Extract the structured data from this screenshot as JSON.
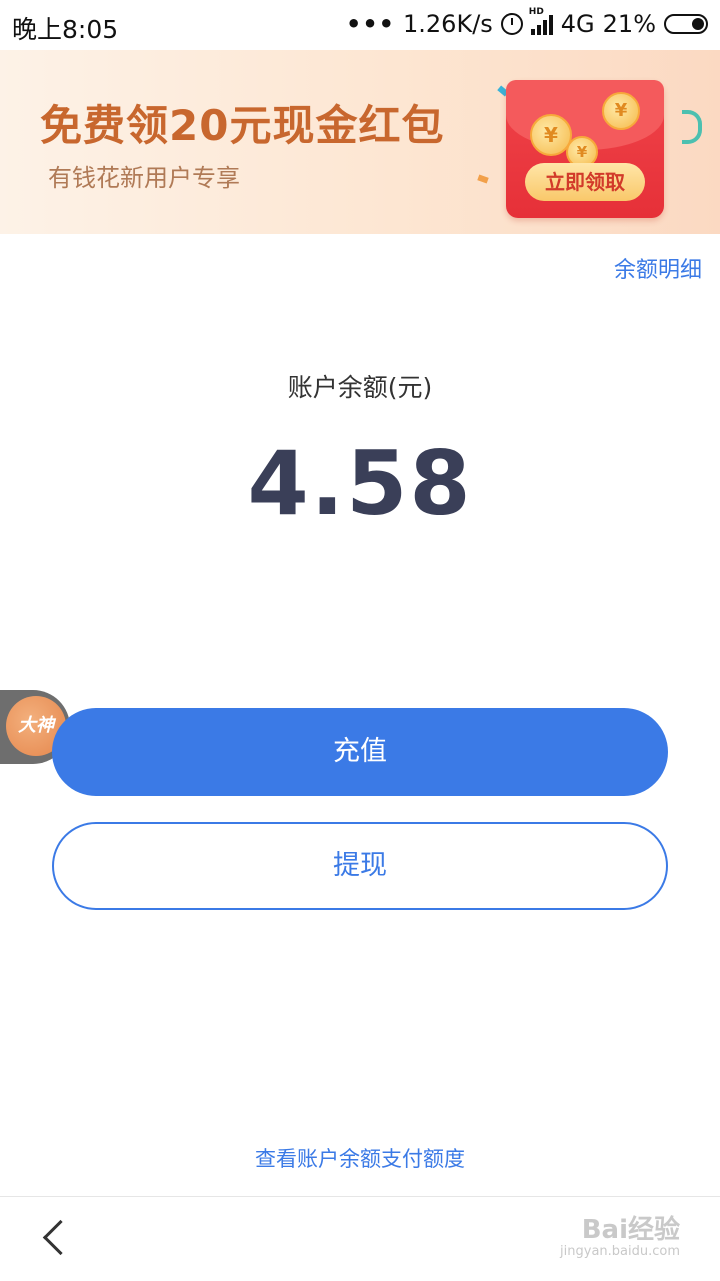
{
  "status_bar": {
    "time": "晚上8:05",
    "dots": "•••",
    "speed": "1.26K/s",
    "hd": "HD",
    "network": "4G",
    "battery": "21%"
  },
  "banner": {
    "title": "免费领20元现金红包",
    "subtitle": "有钱花新用户专享",
    "claim_label": "立即领取",
    "coin_symbol": "¥"
  },
  "header": {
    "detail_link": "余额明细"
  },
  "balance": {
    "label": "账户余额(元)",
    "value": "4.58"
  },
  "actions": {
    "recharge": "充值",
    "withdraw": "提现"
  },
  "float_badge": {
    "label": "大神"
  },
  "footer": {
    "quota_link": "查看账户余额支付额度"
  },
  "watermark": {
    "brand": "Bai经验",
    "url": "jingyan.baidu.com"
  },
  "colors": {
    "accent": "#3b7ae6",
    "balance_text": "#3a3f58",
    "banner_title": "#c8672e",
    "envelope": "#e63038"
  }
}
